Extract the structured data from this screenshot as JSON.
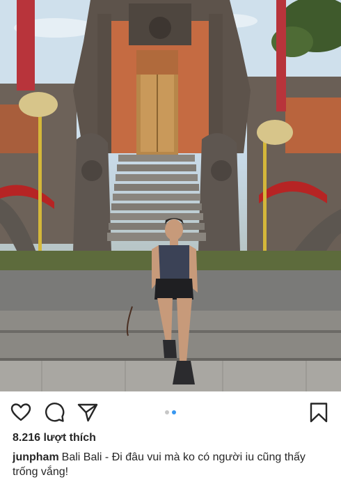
{
  "post": {
    "image_alt": "man-sitting-on-temple-steps",
    "likes_text": "8.216 lượt thích",
    "username": "junpham",
    "caption_text": "Bali Bali - Đi đâu vui mà ko có người iu cũng thấy trống vắng!",
    "carousel": {
      "count": 2,
      "active_index": 1
    }
  },
  "icons": {
    "like": "heart-icon",
    "comment": "comment-bubble-icon",
    "share": "paper-plane-icon",
    "save": "bookmark-icon"
  },
  "colors": {
    "text": "#262626",
    "carousel_active": "#3897f0",
    "carousel_inactive": "#c7c7c7"
  }
}
